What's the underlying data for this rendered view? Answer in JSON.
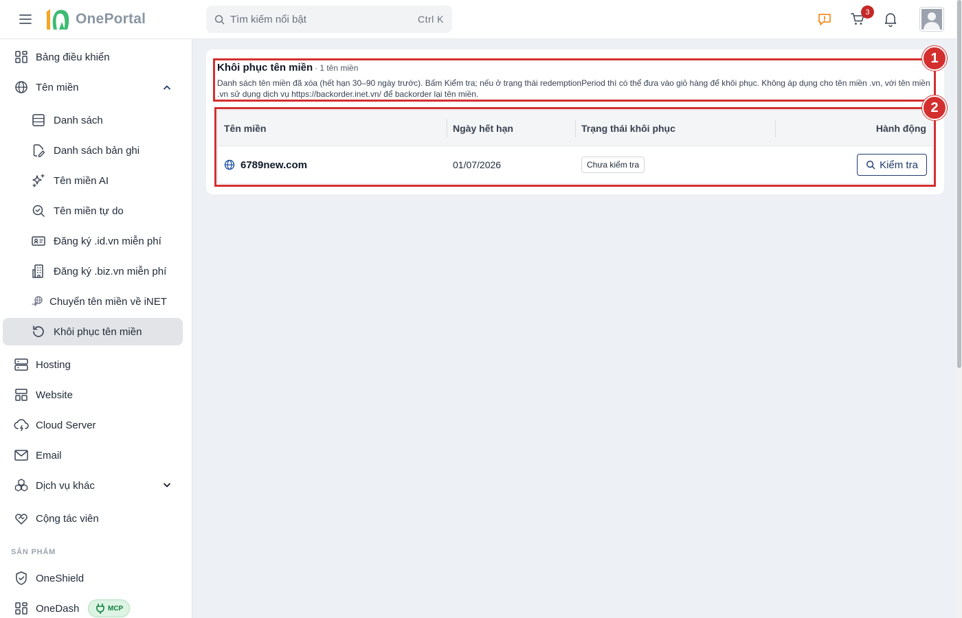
{
  "header": {
    "logo_text": "OnePortal",
    "search_placeholder": "Tìm kiếm nổi bật",
    "search_shortcut": "Ctrl K",
    "cart_count": "3",
    "accent_color": "#f57c00"
  },
  "sidebar": {
    "items": [
      {
        "label": "Bảng điều khiển",
        "icon": "dashboard-grid-icon"
      },
      {
        "label": "Tên miền",
        "icon": "globe-icon",
        "expanded": true
      },
      {
        "label": "Danh sách",
        "icon": "list-icon"
      },
      {
        "label": "Danh sách bản ghi",
        "icon": "file-edit-icon"
      },
      {
        "label": "Tên miền AI",
        "icon": "sparkles-icon"
      },
      {
        "label": "Tên miền tự do",
        "icon": "search-check-icon"
      },
      {
        "label": "Đăng ký .id.vn miễn phí",
        "icon": "id-card-icon"
      },
      {
        "label": "Đăng ký .biz.vn miễn phí",
        "icon": "building-icon"
      },
      {
        "label": "Chuyển tên miền về iNET",
        "icon": "transfer-icon"
      },
      {
        "label": "Khôi phục tên miền",
        "icon": "restore-icon",
        "active": true
      },
      {
        "label": "Hosting",
        "icon": "server-icon"
      },
      {
        "label": "Website",
        "icon": "layout-icon"
      },
      {
        "label": "Cloud Server",
        "icon": "cloud-icon"
      },
      {
        "label": "Email",
        "icon": "mail-icon"
      },
      {
        "label": "Dịch vụ khác",
        "icon": "boxes-icon",
        "expanded": false
      },
      {
        "label": "Cộng tác viên",
        "icon": "handshake-icon"
      }
    ],
    "section_products": "SẢN PHẨM",
    "products": [
      {
        "label": "OneShield",
        "icon": "shield-check-icon"
      },
      {
        "label": "OneDash",
        "icon": "dashboard-grid-icon",
        "badge": "MCP"
      }
    ]
  },
  "main": {
    "title": "Khôi phục tên miền",
    "count_text": "· 1 tên miền",
    "description": "Danh sách tên miền đã xóa (hết hạn 30–90 ngày trước). Bấm Kiểm tra; nếu ở trạng thái redemptionPeriod thì có thể đưa vào giỏ hàng để khôi phục. Không áp dụng cho tên miền .vn, với tên miền .vn sử dụng dịch vụ https://backorder.inet.vn/ để backorder lại tên miền.",
    "table": {
      "columns": [
        "Tên miền",
        "Ngày hết hạn",
        "Trạng thái khôi phục",
        "Hành động"
      ],
      "rows": [
        {
          "domain": "6789new.com",
          "expiry": "01/07/2026",
          "status": "Chưa kiểm tra",
          "action": "Kiểm tra"
        }
      ]
    }
  },
  "annotations": [
    "1",
    "2"
  ]
}
